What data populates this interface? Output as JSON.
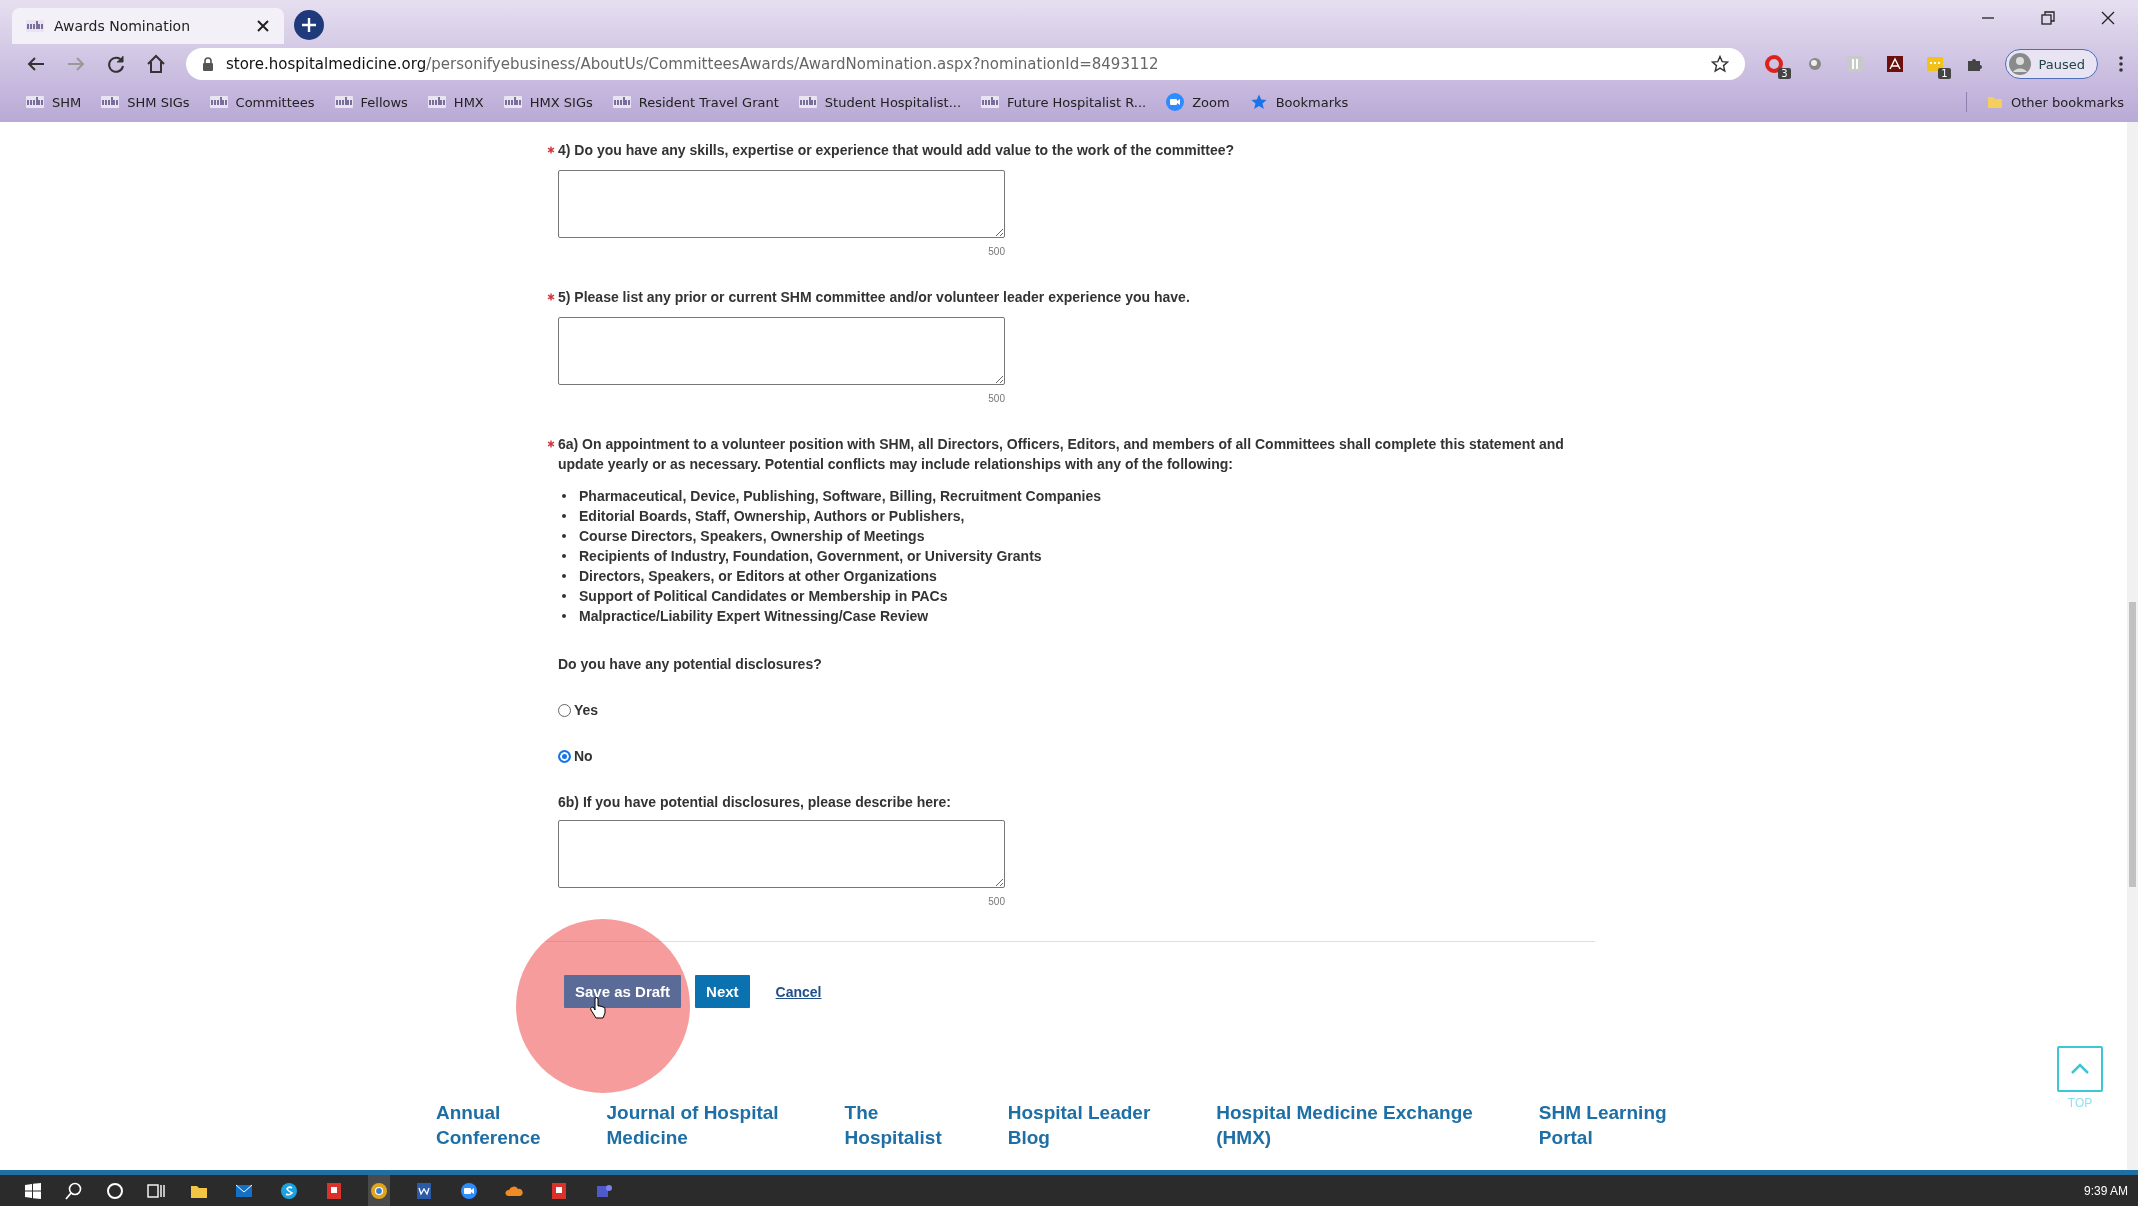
{
  "browser": {
    "tab": {
      "title": "Awards Nomination",
      "selected": true
    },
    "address": {
      "host": "store.hospitalmedicine.org",
      "path": "/personifyebusiness/AboutUs/CommitteesAwards/AwardNomination.aspx?nominationId=8493112"
    },
    "extensions": [
      {
        "kind": "opera",
        "badge": "3"
      },
      {
        "kind": "disc"
      },
      {
        "kind": "tile"
      },
      {
        "kind": "pdf"
      },
      {
        "kind": "note",
        "badge": "1"
      },
      {
        "kind": "puzzle"
      }
    ],
    "profile": {
      "label": "Paused"
    },
    "bookmarks": [
      {
        "kind": "shm",
        "label": "SHM"
      },
      {
        "kind": "shm",
        "label": "SHM SIGs"
      },
      {
        "kind": "shm",
        "label": "Committees"
      },
      {
        "kind": "shm",
        "label": "Fellows"
      },
      {
        "kind": "shm",
        "label": "HMX"
      },
      {
        "kind": "shm",
        "label": "HMX SIGs"
      },
      {
        "kind": "shm",
        "label": "Resident Travel Grant"
      },
      {
        "kind": "shm",
        "label": "Student Hospitalist..."
      },
      {
        "kind": "shm",
        "label": "Future Hospitalist R..."
      },
      {
        "kind": "zoom",
        "label": "Zoom"
      },
      {
        "kind": "star",
        "label": "Bookmarks"
      }
    ],
    "other_bookmarks": "Other bookmarks"
  },
  "form": {
    "questions": [
      {
        "required": true,
        "label": "4) Do you have any skills, expertise or experience that would add value to the work of the committee?",
        "counter": "500"
      },
      {
        "required": true,
        "label": "5) Please list any prior or current SHM committee and/or volunteer leader experience you have.",
        "counter": "500"
      }
    ],
    "statement": {
      "required": true,
      "text": "6a) On appointment to a volunteer position with SHM, all Directors, Officers, Editors, and members of all Committees shall complete this statement and update yearly or as necessary. Potential conflicts may include relationships with any of the following:",
      "items": [
        "Pharmaceutical, Device, Publishing, Software, Billing, Recruitment Companies",
        "Editorial Boards, Staff, Ownership, Authors or Publishers,",
        "Course Directors, Speakers, Ownership of Meetings",
        "Recipients of Industry, Foundation, Government, or University Grants",
        "Directors, Speakers, or Editors at other Organizations",
        "Support of Political Candidates or Membership in PACs",
        "Malpractice/Liability Expert Witnessing/Case Review"
      ]
    },
    "disclosure": {
      "question": "Do you have any potential disclosures?",
      "options": [
        {
          "label": "Yes",
          "selected": false
        },
        {
          "label": "No",
          "selected": true
        }
      ]
    },
    "describe": {
      "label": "6b) If you have potential disclosures, please describe here:",
      "counter": "500"
    },
    "actions": [
      {
        "kind": "draft",
        "label": "Save as Draft"
      },
      {
        "kind": "primary",
        "label": "Next"
      },
      {
        "kind": "link",
        "label": "Cancel"
      }
    ]
  },
  "footer_links": [
    "Annual\nConference",
    "Journal of Hospital\nMedicine",
    "The\nHospitalist",
    "Hospital Leader\nBlog",
    "Hospital Medicine Exchange\n(HMX)",
    "SHM Learning\nPortal"
  ],
  "top_button": {
    "label": "TOP"
  },
  "taskbar": {
    "clock": "9:39 AM"
  }
}
